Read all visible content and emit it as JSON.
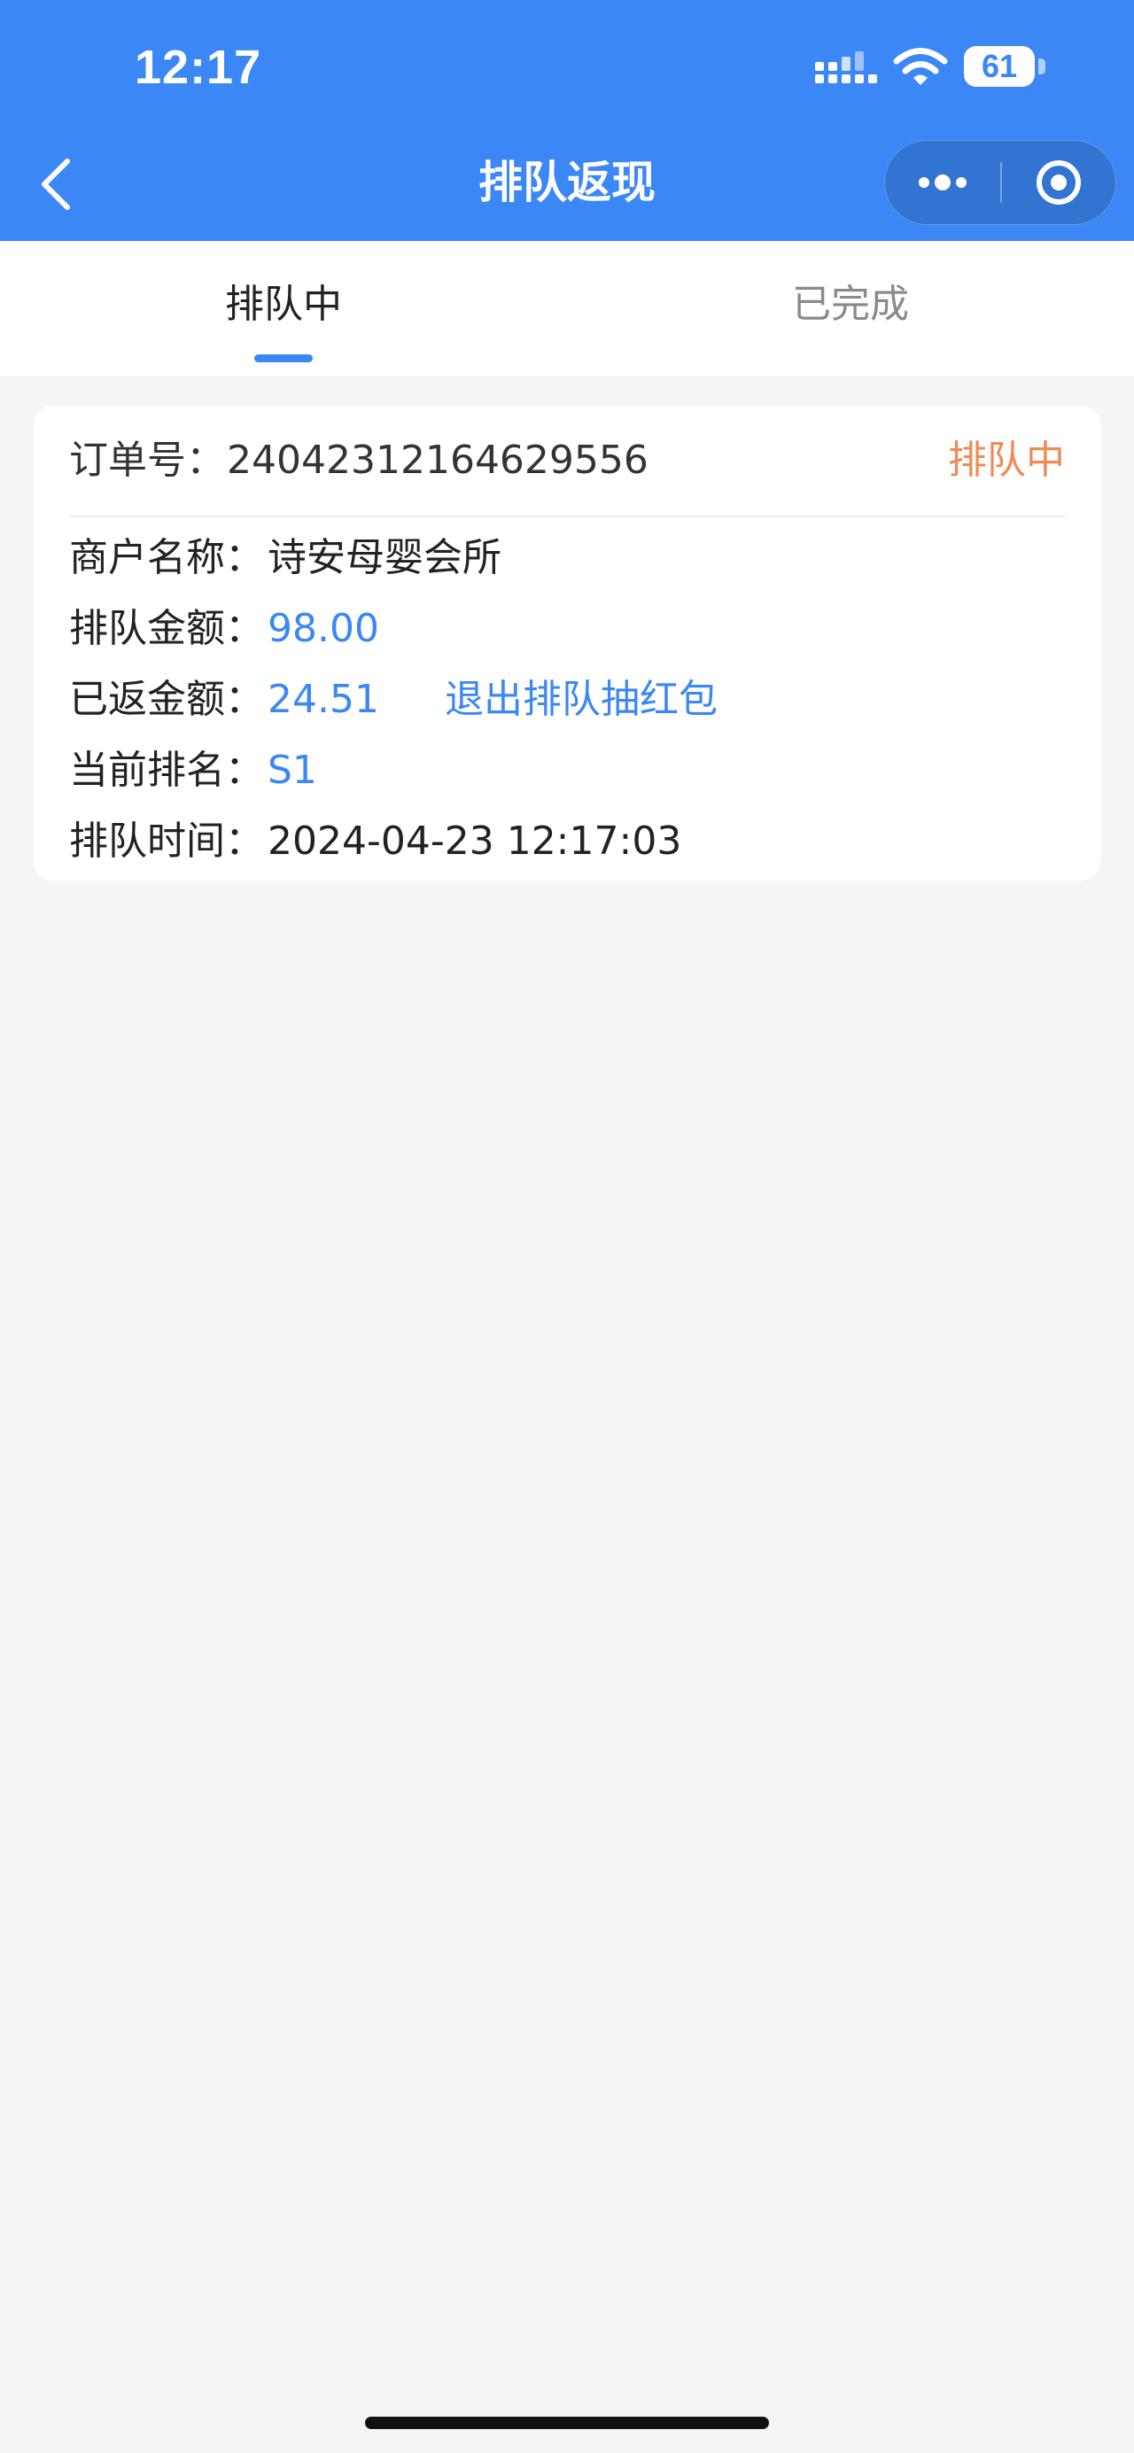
{
  "status_bar": {
    "time": "12:17",
    "battery_level": "61",
    "battery_fraction": 0.61
  },
  "nav": {
    "title": "排队返现",
    "back_icon": "chevron-left-icon",
    "more_icon": "more-dots-icon",
    "close_icon": "target-close-icon"
  },
  "tabs": [
    {
      "label": "排队中",
      "active": true
    },
    {
      "label": "已完成",
      "active": false
    }
  ],
  "order": {
    "order_no_label": "订单号：",
    "order_no": "24042312164629556",
    "status": "排队中",
    "merchant_label": "商户名称：",
    "merchant": "诗安母婴会所",
    "queue_amount_label": "排队金额：",
    "queue_amount": "98.00",
    "returned_amount_label": "已返金额：",
    "returned_amount": "24.51",
    "exit_link": "退出排队抽红包",
    "rank_label": "当前排名：",
    "rank": "S1",
    "queue_time_label": "排队时间：",
    "queue_time": "2024-04-23 12:17:03"
  },
  "colors": {
    "brand": "#3a87f5",
    "status_orange": "#f08a55",
    "background": "#f5f5f5"
  }
}
